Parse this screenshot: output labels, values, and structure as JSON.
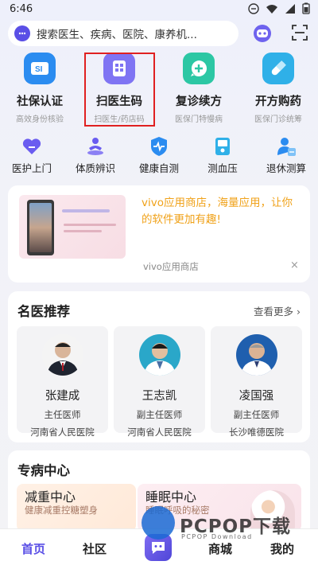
{
  "status_bar": {
    "time": "6:46"
  },
  "search": {
    "placeholder": "搜索医生、疾病、医院、康养机..."
  },
  "main_services": [
    {
      "title": "社保认证",
      "subtitle": "高效身份核验",
      "icon": "si-card-icon",
      "color": "#2b8cf0"
    },
    {
      "title": "扫医生码",
      "subtitle": "扫医生/药店码",
      "icon": "qr-scan-icon",
      "color": "#7f74f3"
    },
    {
      "title": "复诊续方",
      "subtitle": "医保门特慢病",
      "icon": "chat-plus-icon",
      "color": "#2cc7a4"
    },
    {
      "title": "开方购药",
      "subtitle": "医保门诊统筹",
      "icon": "pill-icon",
      "color": "#2fb0e8"
    }
  ],
  "secondary_services": [
    {
      "label": "医护上门",
      "icon": "heart-home-icon"
    },
    {
      "label": "体质辨识",
      "icon": "meditation-icon"
    },
    {
      "label": "健康自测",
      "icon": "shield-pulse-icon"
    },
    {
      "label": "测血压",
      "icon": "blood-pressure-icon"
    },
    {
      "label": "退休测算",
      "icon": "retire-calc-icon"
    }
  ],
  "ad": {
    "text": "vivo应用商店，海量应用，让你的软件更加有趣!",
    "source": "vivo应用商店",
    "close": "×",
    "thumb_caption": "vivo应用商店"
  },
  "doctors": {
    "title": "名医推荐",
    "more": "查看更多",
    "items": [
      {
        "name": "张建成",
        "title": "主任医师",
        "hospital": "河南省人民医院"
      },
      {
        "name": "王志凯",
        "title": "副主任医师",
        "hospital": "河南省人民医院"
      },
      {
        "name": "凌国强",
        "title": "副主任医师",
        "hospital": "长沙唯德医院"
      }
    ]
  },
  "special": {
    "title": "专病中心",
    "items": [
      {
        "title": "减重中心",
        "subtitle": "健康减重控糖塑身"
      },
      {
        "title": "睡眠中心",
        "subtitle": "睡眠呼吸的秘密"
      }
    ]
  },
  "tabbar": {
    "home": "首页",
    "community": "社区",
    "mall": "商城",
    "mine": "我的"
  },
  "watermark": {
    "text": "PCPOP下载",
    "sub": "PCPOP Download"
  },
  "colors": {
    "accent": "#5a4fe6",
    "highlight": "#e02020",
    "ad_text": "#f0a21a"
  }
}
